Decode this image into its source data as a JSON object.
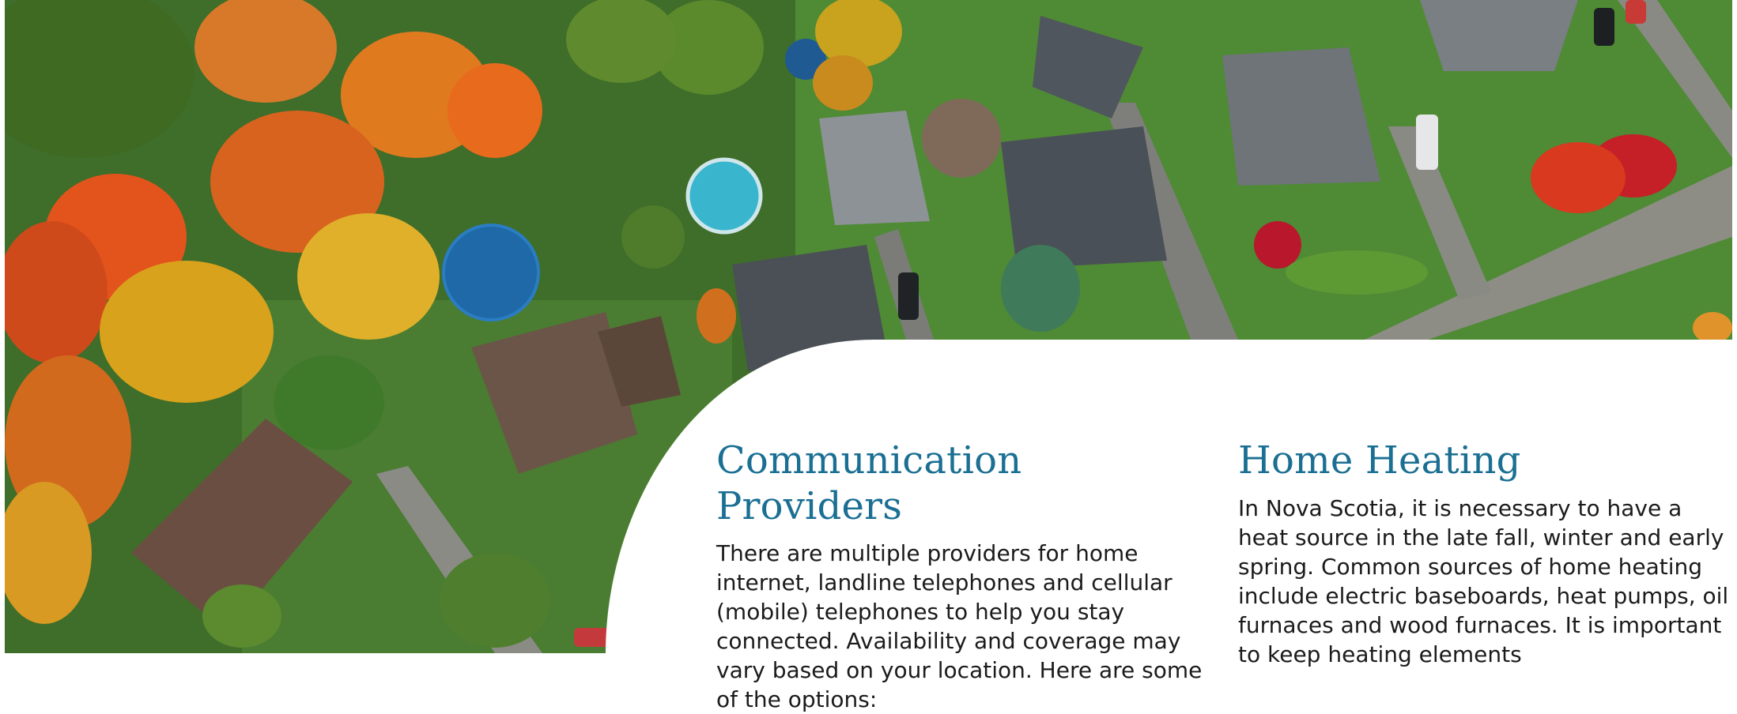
{
  "photo": {
    "subject": "aerial-neighbourhood-photo",
    "colors": {
      "lawn": "#4f8a35",
      "road": "#8d8d85",
      "roof_grey": "#5c6268",
      "roof_brown": "#6b5548",
      "pool": "#39b6cd",
      "foliage_orange": "#d8631f",
      "foliage_red": "#c51f27",
      "foliage_yellow": "#d9a21c",
      "foliage_green": "#477a2c"
    }
  },
  "sections": [
    {
      "title": "Communication Providers",
      "body": "There are multiple providers for home internet, landline telephones and cellular (mobile) telephones to help you stay connected. Availability and coverage may vary based on your location. Here are some of the options:"
    },
    {
      "title": "Home Heating",
      "body": "In Nova Scotia, it is necessary to have a heat source in the late fall, winter and early spring. Common sources of home heating include electric baseboards, heat pumps, oil furnaces and wood furnaces. It is important to keep heating elements"
    }
  ],
  "theme": {
    "heading_color": "#1a6f93",
    "text_color": "#1b1b1b",
    "panel_color": "#ffffff"
  }
}
